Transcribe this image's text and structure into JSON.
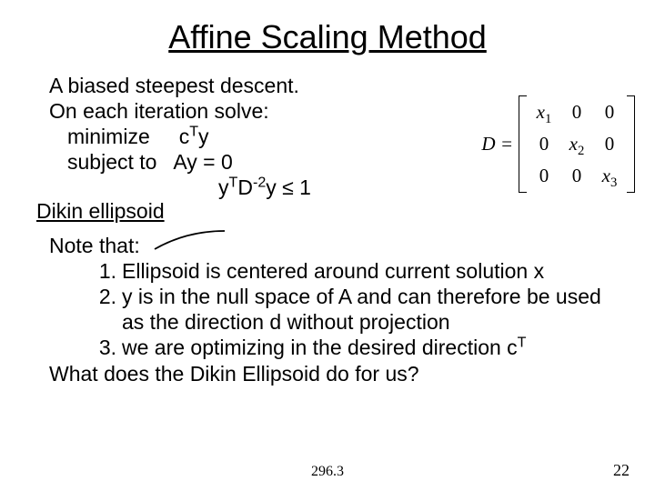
{
  "title": "Affine Scaling Method",
  "intro_line1": "A biased steepest descent.",
  "intro_line2": "On each iteration solve:",
  "opt": {
    "minimize_label": "minimize",
    "minimize_expr_pre": "c",
    "minimize_expr_sup": "T",
    "minimize_expr_post": "y",
    "subject_label": "subject to",
    "subject_expr": "Ay = 0",
    "constraint_pre": "y",
    "constraint_sup1": "T",
    "constraint_mid": "D",
    "constraint_sup2": "-2",
    "constraint_post": "y ≤ 1"
  },
  "dikin_label": "Dikin ellipsoid",
  "matrix": {
    "lhs": "D =",
    "cells": {
      "r1c1_pre": "x",
      "r1c1_sub": "1",
      "r1c2": "0",
      "r1c3": "0",
      "r2c1": "0",
      "r2c2_pre": "x",
      "r2c2_sub": "2",
      "r2c3": "0",
      "r3c1": "0",
      "r3c2": "0",
      "r3c3_pre": "x",
      "r3c3_sub": "3"
    }
  },
  "note_label": "Note that:",
  "notes": {
    "n1_num": "1.",
    "n1_txt": "Ellipsoid is centered around current solution x",
    "n2_num": "2.",
    "n2_txt": "y is in the null space of A and can therefore be used as the direction d without projection",
    "n3_num": "3.",
    "n3_txt_pre": "we are optimizing in the desired direction c",
    "n3_txt_sup": "T"
  },
  "closing_q": "What does the Dikin Ellipsoid do for us?",
  "footer_center": "296.3",
  "footer_right": "22"
}
